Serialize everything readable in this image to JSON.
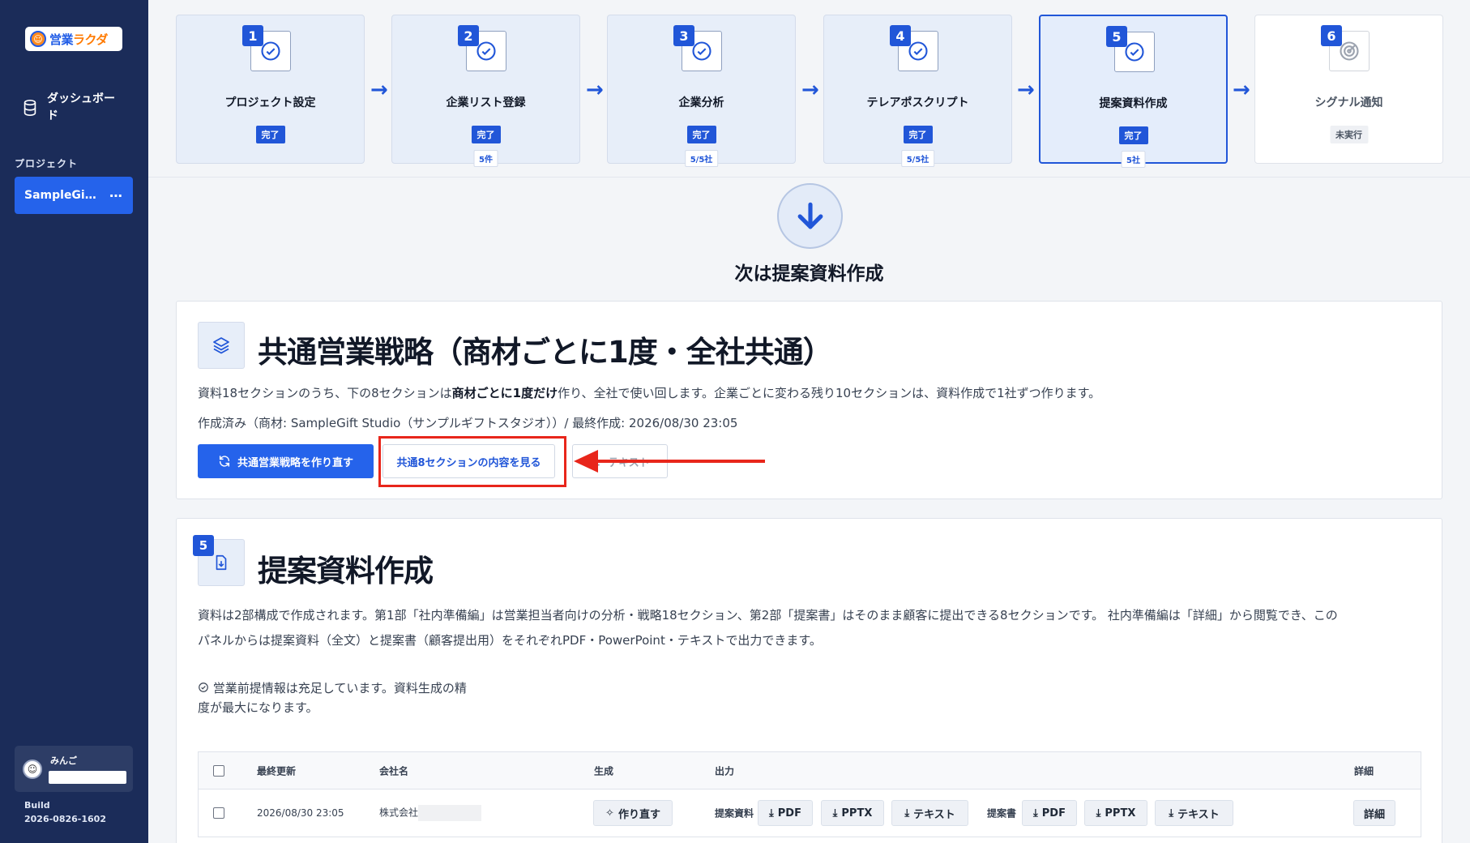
{
  "sidebar": {
    "logo": "営業ラクダ",
    "logo_main": "営業",
    "logo_accent": "ラクダ",
    "nav_dashboard": "ダッシュボード",
    "section_label": "プロジェクト",
    "project_name": "SampleGi…",
    "project_more": "⋯",
    "user_name": "みんご",
    "build_label": "Build",
    "build_number": "2026-0826-1602"
  },
  "steps": [
    {
      "num": "1",
      "title": "プロジェクト設定",
      "status": "完了",
      "count": ""
    },
    {
      "num": "2",
      "title": "企業リスト登録",
      "status": "完了",
      "count": "5件"
    },
    {
      "num": "3",
      "title": "企業分析",
      "status": "完了",
      "count": "5/5社"
    },
    {
      "num": "4",
      "title": "テレアポスクリプト",
      "status": "完了",
      "count": "5/5社"
    },
    {
      "num": "5",
      "title": "提案資料作成",
      "status": "完了",
      "count": "5社"
    },
    {
      "num": "6",
      "title": "シグナル通知",
      "status": "未実行",
      "count": ""
    }
  ],
  "next_label": "次は提案資料作成",
  "strategy": {
    "title": "共通営業戦略（商材ごとに1度・全社共通）",
    "desc_pre": "資料18セクションのうち、下の8セクションは",
    "desc_bold": "商材ごとに1度だけ",
    "desc_post": "作り、全社で使い回します。企業ごとに変わる残り10セクションは、資料作成で1社ずつ作ります。",
    "meta": "作成済み（商材: SampleGift Studio（サンプルギフトスタジオ））/ 最終作成: 2026/08/30 23:05",
    "regen_button": "共通営業戦略を作り直す",
    "view_button": "共通8セクションの内容を見る",
    "text_button": "テキスト"
  },
  "proposal": {
    "badge": "5",
    "title": "提案資料作成",
    "desc_line1": "資料は2部構成で作成されます。第1部「社内準備編」は営業担当者向けの分析・戦略18セクション、第2部「提案書」はそのまま顧客に提出できる8セクションです。 社内準備編は「詳細」から閲覧でき、この",
    "desc_line2": "パネルからは提案資料（全文）と提案書（顧客提出用）をそれぞれPDF・PowerPoint・テキストで出力できます。",
    "notice_line1": "営業前提情報は充足しています。資料生成の精",
    "notice_line2": "度が最大になります。",
    "table": {
      "headers": {
        "updated": "最終更新",
        "company": "会社名",
        "generate": "生成",
        "output": "出力",
        "detail": "詳細"
      },
      "rows": [
        {
          "updated": "2026/08/30 23:05",
          "company": "株式会社",
          "regen": "作り直す",
          "doc_label": "提案資料",
          "doc_pdf": "PDF",
          "doc_pptx": "PPTX",
          "doc_text": "テキスト",
          "prop_label": "提案書",
          "prop_pdf": "PDF",
          "prop_pptx": "PPTX",
          "prop_text": "テキスト",
          "detail": "詳細"
        }
      ]
    }
  }
}
